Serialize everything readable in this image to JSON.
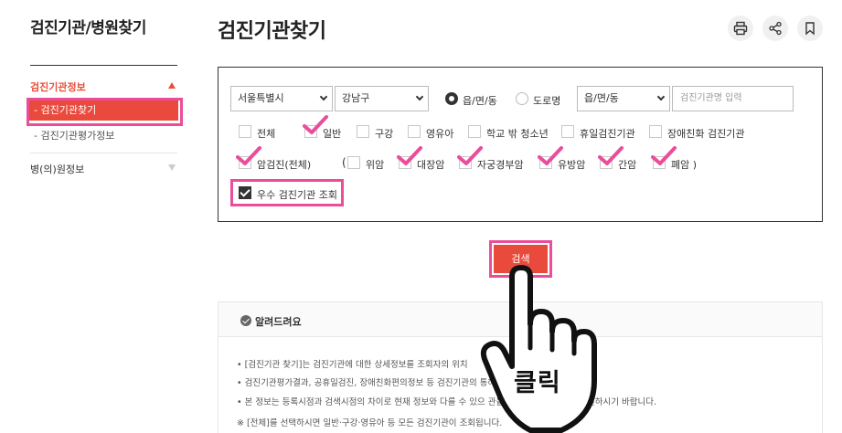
{
  "sidebar": {
    "title": "검진기관/병원찾기",
    "section1": {
      "label": "검진기관정보",
      "items": [
        {
          "label": "검진기관찾기",
          "active": true
        },
        {
          "label": "검진기관평가정보",
          "active": false
        }
      ]
    },
    "section2": {
      "label": "병(의)원정보"
    }
  },
  "header": {
    "title": "검진기관찾기",
    "icons": [
      "print-icon",
      "share-icon",
      "bookmark-icon"
    ]
  },
  "search": {
    "region_select": "서울특별시",
    "district_select": "강남구",
    "radios": [
      {
        "label": "읍/면/동",
        "checked": true
      },
      {
        "label": "도로명",
        "checked": false
      }
    ],
    "town_select": "읍/면/동",
    "name_placeholder": "검진기관명 입력",
    "row1": [
      {
        "label": "전체",
        "checked": false
      },
      {
        "label": "일반",
        "checked": true
      },
      {
        "label": "구강",
        "checked": false
      },
      {
        "label": "영유아",
        "checked": false
      },
      {
        "label": "학교 밖 청소년",
        "checked": false
      },
      {
        "label": "휴일검진기관",
        "checked": false
      },
      {
        "label": "장애친화 검진기관",
        "checked": false
      }
    ],
    "row2_group": {
      "label": "암검진(전체)",
      "checked": true
    },
    "row2_open_paren": "(",
    "row2": [
      {
        "label": "위암",
        "checked": false
      },
      {
        "label": "대장암",
        "checked": true
      },
      {
        "label": "자궁경부암",
        "checked": true
      },
      {
        "label": "유방암",
        "checked": true
      },
      {
        "label": "간암",
        "checked": true
      },
      {
        "label": "폐암 )",
        "checked": true
      }
    ],
    "excellent": {
      "label": "우수 검진기관 조회",
      "checked": true
    },
    "button_label": "검색"
  },
  "notice": {
    "title": "알려드려요",
    "lines": [
      "• [검진기관 찾기]는 검진기관에 대한 상세정보를 조회자의 위치                                                      ",
      "• 검진기관평가결과, 공휴일검진, 장애친화편의정보 등 검진기관의                                                      통해 확인하실 수 있습니다.",
      "• 본 정보는 등록시점과 검색시점의 차이로 현재 정보와 다를 수 있으                                                      관을 통해 필요한 정보를 확인하시기 바랍니다.",
      "※ [전체]를 선택하시면 일반·구강·영유아 등 모든 검진기관이 조회됩니다."
    ]
  },
  "overlay": {
    "label": "클릭"
  },
  "colors": {
    "accent": "#e84a3c",
    "highlight": "#ea4d9a"
  }
}
